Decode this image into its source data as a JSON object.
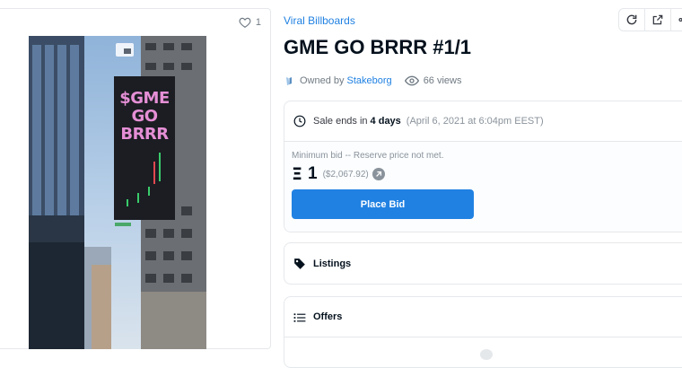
{
  "media": {
    "favorites_count": "1",
    "billboard_text": "$GME GO BRRR"
  },
  "asset": {
    "collection": "Viral Billboards",
    "title": "GME GO BRRR #1/1",
    "owned_by_label": "Owned by",
    "owner": "Stakeborg",
    "views": "66 views"
  },
  "toolbar": {
    "icons": [
      "refresh-icon",
      "external-link-icon",
      "share-icon"
    ]
  },
  "sale": {
    "prefix": "Sale ends in",
    "duration": "4 days",
    "date": "(April 6, 2021 at 6:04pm EEST)",
    "min_bid_text": "Minimum bid -- Reserve price not met.",
    "currency_symbol": "Ξ",
    "price": "1",
    "usd": "($2,067.92)",
    "button": "Place Bid"
  },
  "sections": {
    "listings": "Listings",
    "offers": "Offers"
  },
  "colors": {
    "accent": "#2081e2",
    "text": "#04111d",
    "muted": "#8a939b",
    "border": "#e5e8eb"
  }
}
